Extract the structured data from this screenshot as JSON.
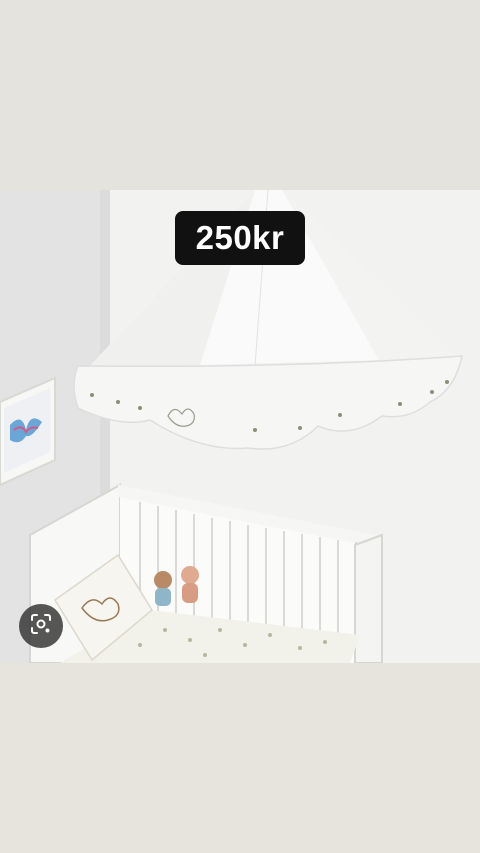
{
  "price": {
    "label": "250kr",
    "background": "#111111",
    "color": "#ffffff"
  },
  "lens_button": {
    "icon": "lens-search-icon"
  },
  "colors": {
    "top_band": "#e4e3de",
    "bottom_band": "#e6e4dd"
  }
}
